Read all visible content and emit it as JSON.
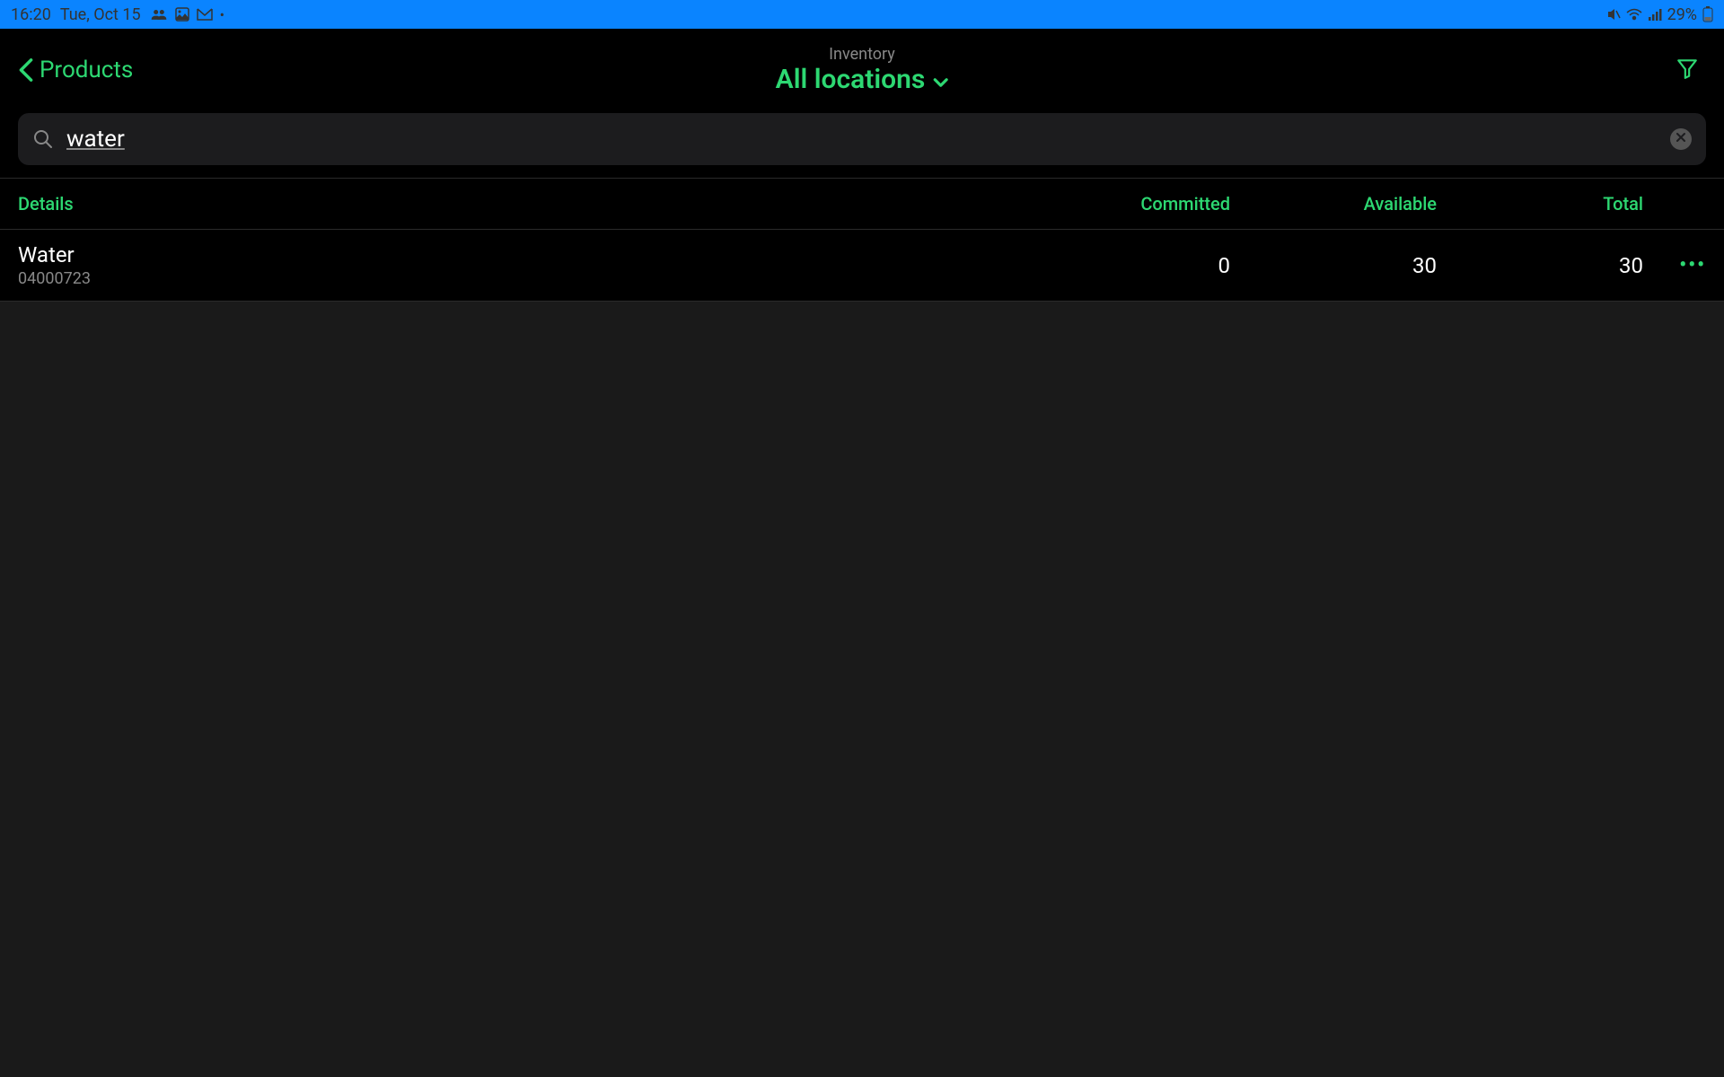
{
  "status_bar": {
    "time": "16:20",
    "date": "Tue, Oct 15",
    "battery": "29%"
  },
  "header": {
    "back_label": "Products",
    "subtitle": "Inventory",
    "location": "All locations"
  },
  "search": {
    "value": "water"
  },
  "columns": {
    "details": "Details",
    "committed": "Committed",
    "available": "Available",
    "total": "Total"
  },
  "rows": [
    {
      "name": "Water",
      "sku": "04000723",
      "committed": "0",
      "available": "30",
      "total": "30"
    }
  ]
}
